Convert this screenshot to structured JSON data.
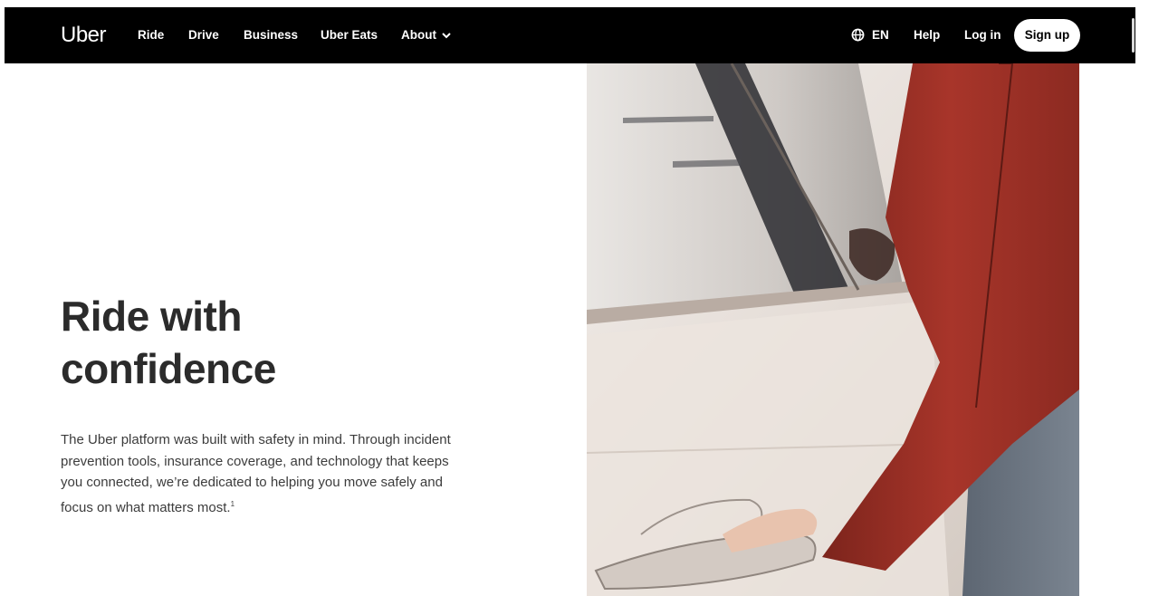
{
  "nav": {
    "logo": "Uber",
    "links": [
      {
        "label": "Ride"
      },
      {
        "label": "Drive"
      },
      {
        "label": "Business"
      },
      {
        "label": "Uber Eats"
      },
      {
        "label": "About"
      }
    ],
    "language": "EN",
    "help": "Help",
    "login": "Log in",
    "signup": "Sign up"
  },
  "hero": {
    "title_line1": "Ride with",
    "title_line2": "confidence",
    "body": "The Uber platform was built with safety in mind. Through incident prevention tools, insurance coverage, and technology that keeps you connected, we’re dedicated to helping you move safely and focus on what matters most.",
    "footnote": "1",
    "image": "person-opening-car-door-photo"
  },
  "icons": {
    "globe": "globe-icon",
    "about_chevron": "chevron-down-icon"
  },
  "colors": {
    "nav_bg": "#000000",
    "nav_text": "#ffffff",
    "signup_bg": "#ffffff",
    "headline": "#2b2b2b",
    "jacket": "#9e2d22"
  }
}
